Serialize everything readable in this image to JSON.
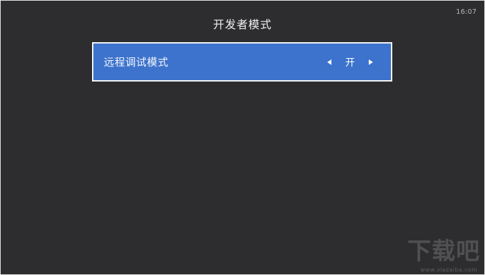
{
  "status_bar": {
    "time": "16:07"
  },
  "header": {
    "title": "开发者模式"
  },
  "settings": {
    "items": [
      {
        "label": "远程调试模式",
        "value": "开",
        "left_icon": "arrow-left-icon",
        "right_icon": "arrow-right-icon"
      }
    ]
  },
  "watermark": {
    "logo_text": "下载吧",
    "url": "www.xiazaiba.com"
  },
  "colors": {
    "background": "#2d2d30",
    "selected_row": "#3d73cc",
    "selected_border": "#f5f5f5",
    "text": "#ffffff"
  }
}
